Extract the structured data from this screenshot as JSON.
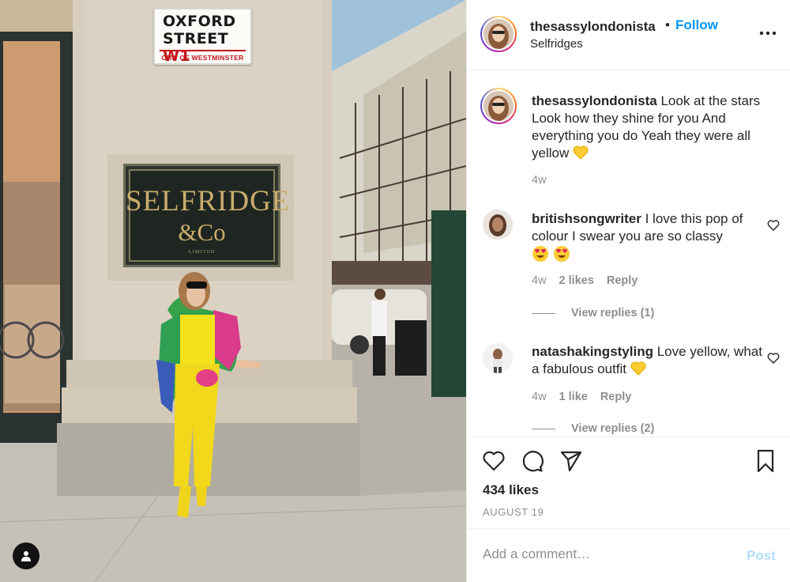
{
  "photo": {
    "street_sign": {
      "line1": "OXFORD",
      "line2_street": "STREET",
      "line2_code": "W1",
      "line3": "CITY OF WESTMINSTER"
    },
    "store_plaque": {
      "line1": "SELFRIDGE",
      "line2": "&Co",
      "line3": "LIMITED"
    },
    "user_tag_icon": "person-icon"
  },
  "header": {
    "username": "thesassylondonista",
    "separator": "•",
    "follow_label": "Follow",
    "location": "Selfridges",
    "more_icon": "more-options-icon"
  },
  "caption": {
    "username": "thesassylondonista",
    "text": "Look at the stars Look how they shine for you And everything you do Yeah they were all yellow",
    "age": "4w"
  },
  "comments": [
    {
      "username": "britishsongwriter",
      "text": "I love this pop of colour I swear you are so classy",
      "age": "4w",
      "likes": "2 likes",
      "reply_label": "Reply",
      "view_replies": "View replies (1)"
    },
    {
      "username": "natashakingstyling",
      "text": "Love yellow, what a fabulous outfit",
      "age": "4w",
      "likes": "1 like",
      "reply_label": "Reply",
      "view_replies": "View replies (2)"
    }
  ],
  "actions": {
    "icons": [
      "heart-icon",
      "comment-icon",
      "share-icon",
      "bookmark-icon"
    ],
    "likes_count": "434 likes",
    "date": "AUGUST 19"
  },
  "add_comment": {
    "placeholder": "Add a comment…",
    "post_label": "Post"
  },
  "colors": {
    "accent_blue": "#0095f6",
    "post_disabled": "#b2dffc",
    "muted_text": "#8e8e8e",
    "text": "#262626",
    "emoji_yellow_heart": "#ffcc33"
  }
}
